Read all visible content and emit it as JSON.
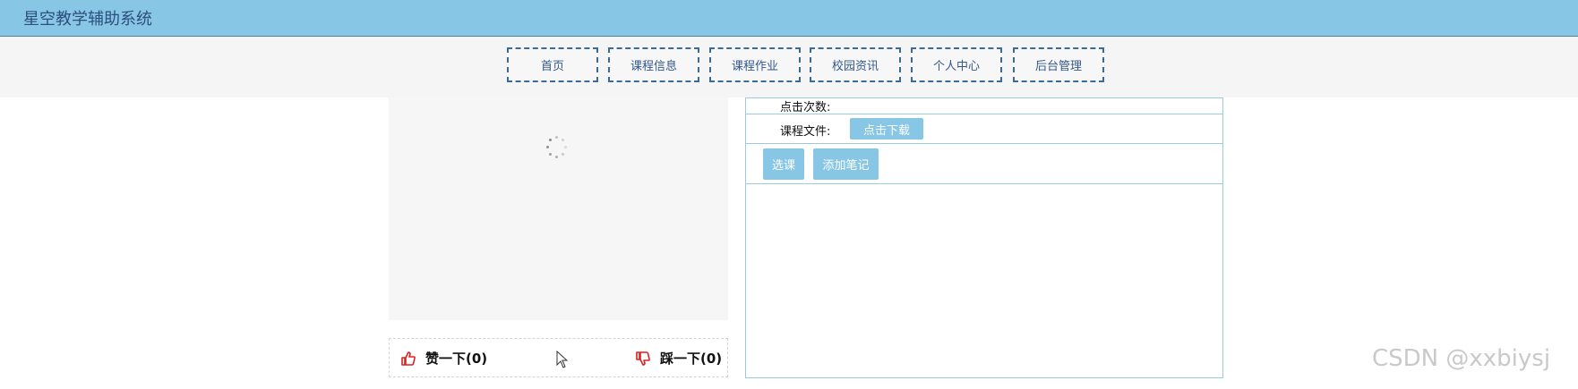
{
  "app": {
    "title": "星空教学辅助系统"
  },
  "nav": {
    "items": [
      {
        "id": "home",
        "label": "首页"
      },
      {
        "id": "course-info",
        "label": "课程信息"
      },
      {
        "id": "course-homework",
        "label": "课程作业"
      },
      {
        "id": "campus-news",
        "label": "校园资讯"
      },
      {
        "id": "personal-center",
        "label": "个人中心"
      },
      {
        "id": "admin",
        "label": "后台管理"
      }
    ]
  },
  "details": {
    "clicks_label": "点击次数:",
    "clicks_value": "",
    "file_label": "课程文件:",
    "download_button": "点击下载",
    "select_course_button": "选课",
    "add_note_button": "添加笔记"
  },
  "votes": {
    "like_label": "赞一下(0)",
    "dislike_label": "踩一下(0)"
  },
  "watermark": "CSDN @xxbiysj",
  "colors": {
    "header_bg": "#87c6e4",
    "nav_border": "#3a6a9a",
    "button_bg": "#87c6e4",
    "like_icon": "#e02020",
    "panel_border": "#9ccbe0"
  },
  "icons": {
    "like": "thumbs-up-icon",
    "dislike": "thumbs-down-icon",
    "loading": "loading-spinner-icon",
    "cursor": "mouse-cursor-icon"
  }
}
